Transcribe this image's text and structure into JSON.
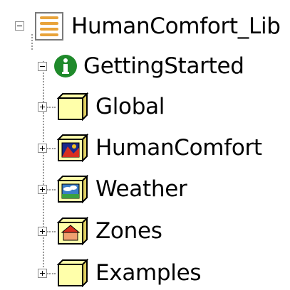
{
  "tree": {
    "root": {
      "label": "HumanComfort_Lib",
      "icon": "library-icon",
      "expanded": true
    },
    "children": [
      {
        "label": "GettingStarted",
        "icon": "info-icon",
        "expanded": true,
        "color": "#1f8a2b"
      },
      {
        "label": "Global",
        "icon": "package-icon",
        "expanded": false
      },
      {
        "label": "HumanComfort",
        "icon": "human-comfort-package-icon",
        "expanded": false
      },
      {
        "label": "Weather",
        "icon": "weather-package-icon",
        "expanded": false
      },
      {
        "label": "Zones",
        "icon": "zones-package-icon",
        "expanded": false
      },
      {
        "label": "Examples",
        "icon": "package-icon",
        "expanded": false
      }
    ]
  },
  "colors": {
    "package_fill": "#ffffaa",
    "package_edge": "#000000",
    "library_orange": "#e8a33a",
    "guide_line": "#9a9a9a"
  }
}
